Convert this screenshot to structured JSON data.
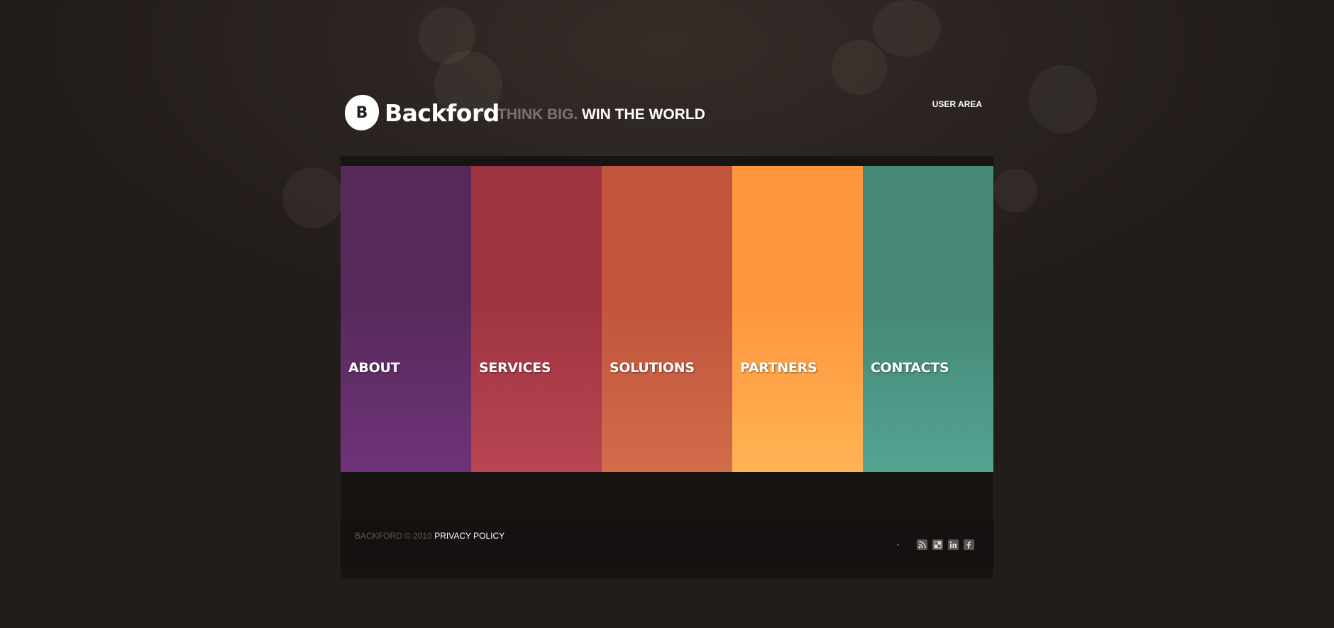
{
  "brand": {
    "logo_letter": "B",
    "name": "Backford",
    "slogan_part1": "THINK BIG.",
    "slogan_part2": "WIN THE WORLD"
  },
  "header": {
    "user_area_label": "USER AREA"
  },
  "nav": {
    "items": [
      {
        "label": "ABOUT",
        "color_top": "#582a5b",
        "color_bottom": "#6e3279"
      },
      {
        "label": "SERVICES",
        "color_top": "#9f3441",
        "color_bottom": "#b84552"
      },
      {
        "label": "SOLUTIONS",
        "color_top": "#c0553b",
        "color_bottom": "#d26c4b"
      },
      {
        "label": "PARTNERS",
        "color_top": "#ff963e",
        "color_bottom": "#ffb354"
      },
      {
        "label": "CONTACTS",
        "color_top": "#468777",
        "color_bottom": "#54a492"
      }
    ]
  },
  "footer": {
    "copyright": "BACKFORD © 2010",
    "privacy_label": "PRIVACY POLICY",
    "social_icons": [
      "rss-icon",
      "delicious-icon",
      "linkedin-icon",
      "facebook-icon"
    ]
  }
}
